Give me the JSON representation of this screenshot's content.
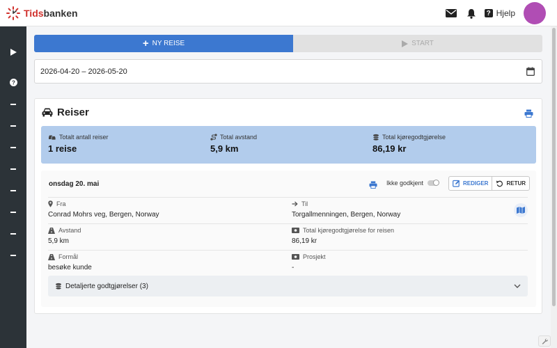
{
  "app": {
    "logo_brand": "Tids",
    "logo_rest": "banken"
  },
  "header": {
    "help_label": "Hjelp",
    "help_glyph": "?"
  },
  "toolbar": {
    "new_trip_label": "NY REISE",
    "start_label": "START"
  },
  "date_range": {
    "value": "2026-04-20 – 2026-05-20"
  },
  "trips_card": {
    "title": "Reiser",
    "summary": {
      "total_trips_label": "Totalt antall reiser",
      "total_trips_value": "1 reise",
      "total_distance_label": "Total avstand",
      "total_distance_value": "5,9 km",
      "total_allowance_label": "Total kjøregodtgjørelse",
      "total_allowance_value": "86,19 kr"
    },
    "trip": {
      "date": "onsdag 20. mai",
      "approval_label": "Ikke godkjent",
      "approved": false,
      "edit_label": "REDIGER",
      "return_label": "RETUR",
      "from_label": "Fra",
      "from_value": "Conrad Mohrs veg, Bergen, Norway",
      "to_label": "Til",
      "to_value": "Torgallmenningen, Bergen, Norway",
      "distance_label": "Avstand",
      "distance_value": "5,9 km",
      "trip_allowance_label": "Total kjøregodtgjørelse for reisen",
      "trip_allowance_value": "86,19 kr",
      "purpose_label": "Formål",
      "purpose_value": "besøke kunde",
      "project_label": "Prosjekt",
      "project_value": "-",
      "details_label": "Detaljerte godtgjørelser (3)"
    }
  },
  "colors": {
    "primary": "#3c78d0",
    "summary_bg": "#b2ccec",
    "sidebar_bg": "#2c3338",
    "avatar": "#b04db4",
    "logo_red": "#d0302c"
  },
  "icons": {
    "sidebar": [
      "play-icon",
      "help-circle-icon",
      "menu-dash-icon"
    ],
    "header": [
      "mail-icon",
      "bell-icon",
      "help-icon"
    ]
  }
}
